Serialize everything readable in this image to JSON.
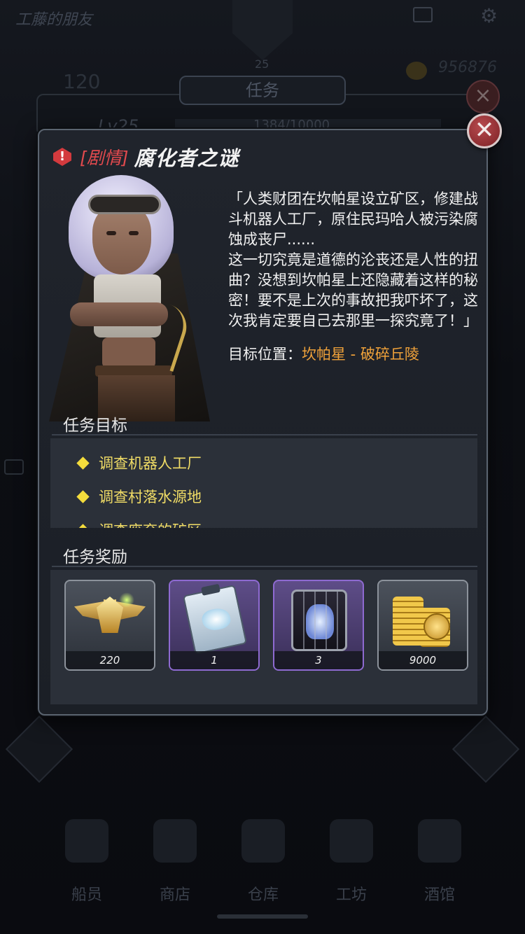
{
  "background": {
    "screen_title": "工藤的朋友",
    "level_badge": "25",
    "energy": "120",
    "coins": "956876",
    "tab_title": "任务",
    "player_level": "Lv25",
    "xp_text": "1384/10000",
    "nav": [
      {
        "label": "船员",
        "icon": "crew-icon"
      },
      {
        "label": "商店",
        "icon": "shop-icon"
      },
      {
        "label": "仓库",
        "icon": "warehouse-icon"
      },
      {
        "label": "工坊",
        "icon": "workshop-icon"
      },
      {
        "label": "酒馆",
        "icon": "tavern-icon"
      }
    ]
  },
  "modal": {
    "alert_symbol": "!",
    "tag": "[剧情]",
    "title": "腐化者之谜",
    "story": "「人类财团在坎帕星设立矿区，修建战斗机器人工厂，原住民玛哈人被污染腐蚀成丧尸......\n这一切究竟是道德的沦丧还是人性的扭曲？没想到坎帕星上还隐藏着这样的秘密！要不是上次的事故把我吓坏了，这次我肯定要自己去那里一探究竟了！」",
    "target_label": "目标位置：",
    "target_value": "坎帕星 - 破碎丘陵",
    "objectives_title": "任务目标",
    "objectives": [
      "调查机器人工厂",
      "调查村落水源地",
      "调查废弃的矿区"
    ],
    "rewards_title": "任务奖励",
    "rewards": [
      {
        "icon": "medal-icon",
        "count": "220",
        "rarity": "normal"
      },
      {
        "icon": "blueprint-icon",
        "count": "1",
        "rarity": "epic"
      },
      {
        "icon": "mech-armor-icon",
        "count": "3",
        "rarity": "epic"
      },
      {
        "icon": "gold-coins-icon",
        "count": "9000",
        "rarity": "normal"
      }
    ],
    "close_symbol": "✕"
  },
  "colors": {
    "accent_red": "#e24a4e",
    "objective_yellow": "#f0dc66",
    "target_orange": "#f0a23a",
    "epic_purple": "#8e6ad1"
  }
}
